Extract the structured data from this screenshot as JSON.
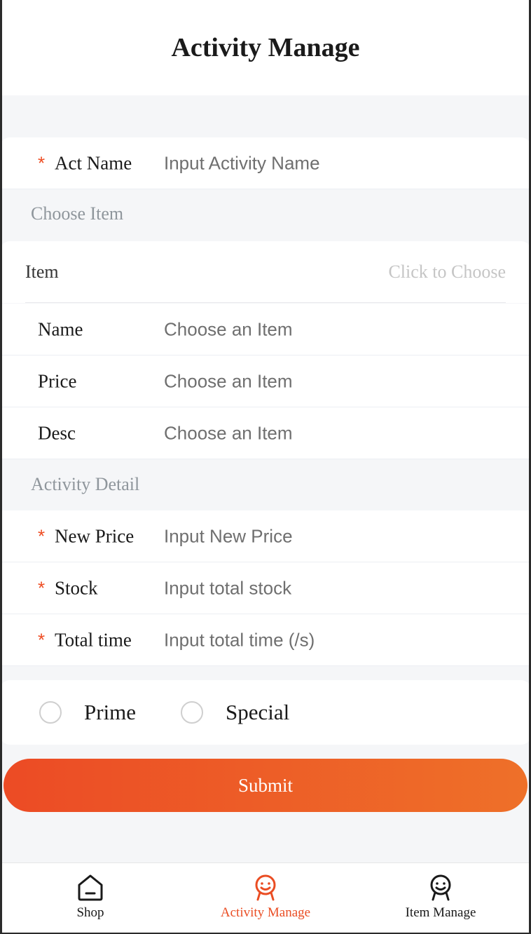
{
  "header": {
    "title": "Activity Manage"
  },
  "basic": {
    "act_name": {
      "label": "Act Name",
      "placeholder": "Input Activity Name",
      "required": "*"
    }
  },
  "choose_item": {
    "section_title": "Choose Item",
    "item_label": "Item",
    "item_action": "Click to Choose",
    "fields": [
      {
        "label": "Name",
        "placeholder": "Choose an Item"
      },
      {
        "label": "Price",
        "placeholder": "Choose an Item"
      },
      {
        "label": "Desc",
        "placeholder": "Choose an Item"
      }
    ]
  },
  "activity_detail": {
    "section_title": "Activity Detail",
    "fields": [
      {
        "label": "New Price",
        "placeholder": "Input New Price",
        "required": "*"
      },
      {
        "label": "Stock",
        "placeholder": "Input total stock",
        "required": "*"
      },
      {
        "label": "Total time",
        "placeholder": "Input total time (/s)",
        "required": "*"
      }
    ]
  },
  "types": {
    "options": [
      {
        "label": "Prime",
        "selected": false
      },
      {
        "label": "Special",
        "selected": false
      }
    ]
  },
  "submit": {
    "label": "Submit"
  },
  "tabbar": {
    "items": [
      {
        "label": "Shop",
        "icon": "home-icon",
        "active": false
      },
      {
        "label": "Activity Manage",
        "icon": "activity-smile-icon",
        "active": true
      },
      {
        "label": "Item Manage",
        "icon": "item-smile-icon",
        "active": false
      }
    ]
  },
  "colors": {
    "accent": "#ea4d23",
    "accent_gradient_end": "#ee7029",
    "background": "#f5f6f8",
    "section_title": "#8f969c",
    "placeholder": "#6f6f6f"
  }
}
